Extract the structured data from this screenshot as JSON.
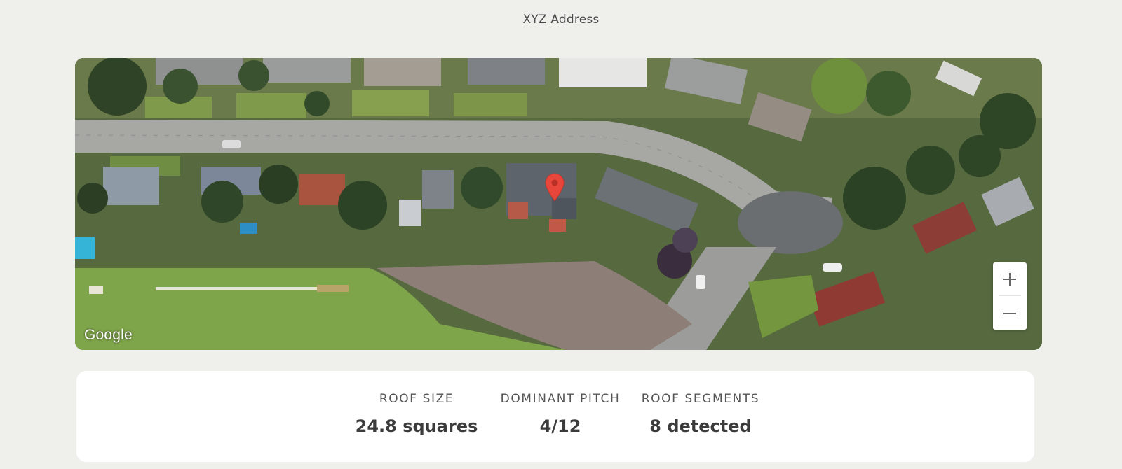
{
  "header": {
    "address": "XYZ Address"
  },
  "map": {
    "attribution": "Google",
    "marker_icon": "map-pin-icon",
    "marker_color": "#e8463a",
    "zoom_in_icon": "plus-icon",
    "zoom_out_icon": "minus-icon"
  },
  "stats": [
    {
      "label": "ROOF SIZE",
      "value": "24.8 squares"
    },
    {
      "label": "DOMINANT PITCH",
      "value": "4/12"
    },
    {
      "label": "ROOF SEGMENTS",
      "value": "8 detected"
    }
  ]
}
